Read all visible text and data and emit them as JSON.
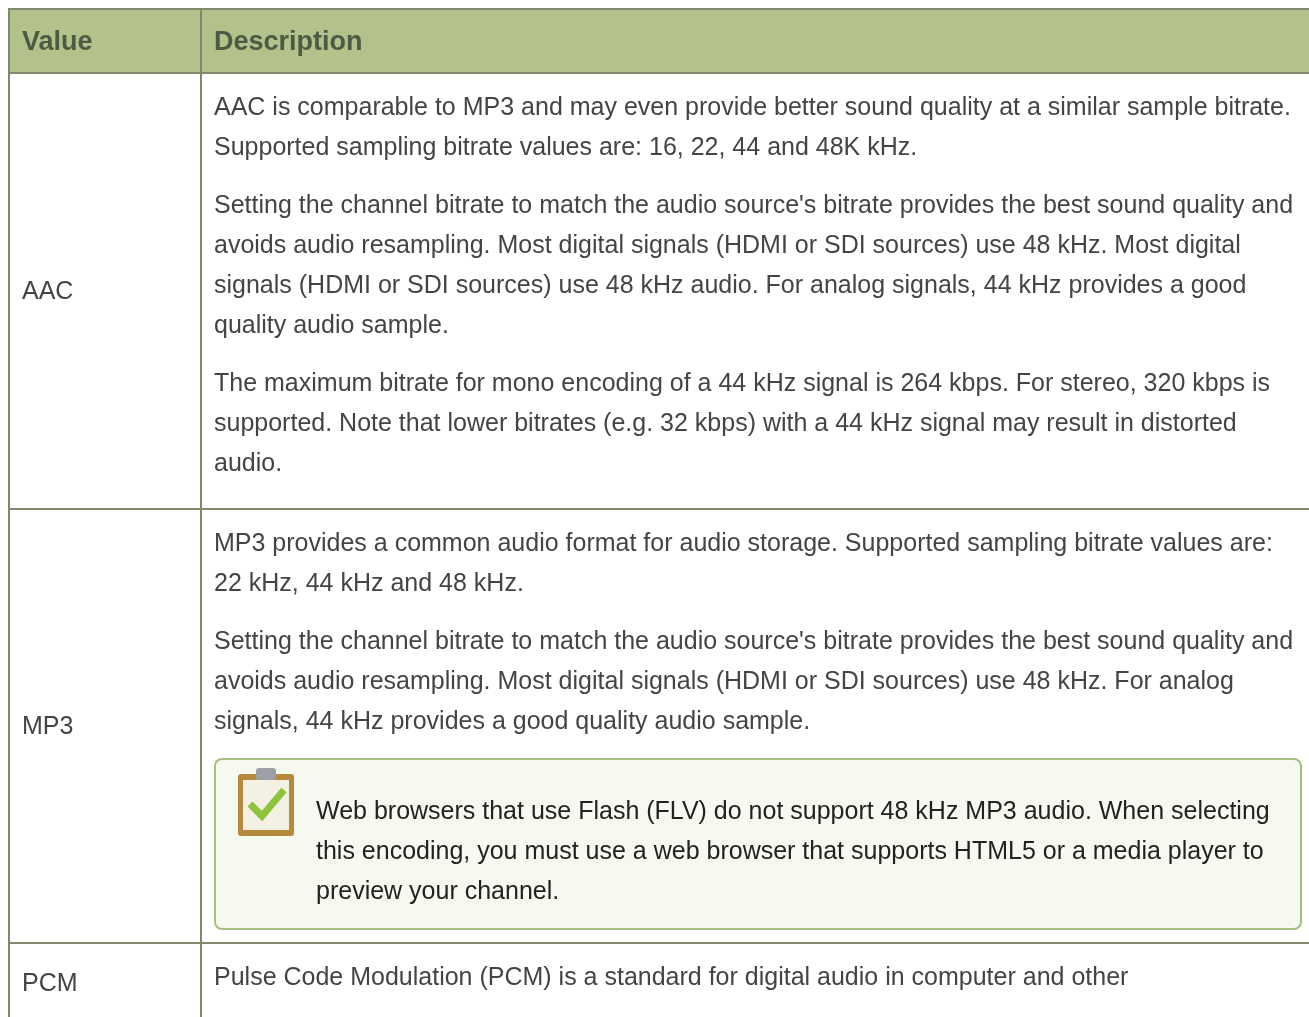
{
  "table": {
    "columns": [
      "Value",
      "Description"
    ],
    "rows": [
      {
        "value": "AAC",
        "paragraphs": [
          "AAC is comparable to MP3 and may even provide better sound quality at a similar sample bitrate. Supported sampling bitrate values are: 16, 22, 44 and 48K kHz.",
          "Setting the channel bitrate to match the audio source's bitrate provides the best sound quality and avoids audio resampling. Most digital signals (HDMI or SDI sources) use 48 kHz. Most digital signals (HDMI or SDI sources) use 48 kHz audio. For analog signals, 44 kHz provides a good quality audio sample.",
          "The maximum bitrate for mono encoding of a 44 kHz signal is 264 kbps. For stereo, 320 kbps is supported. Note that lower bitrates (e.g. 32 kbps) with a 44 kHz signal may result in distorted audio."
        ]
      },
      {
        "value": "MP3",
        "paragraphs": [
          "MP3 provides a common audio format for audio storage. Supported sampling bitrate values are: 22 kHz, 44 kHz and 48 kHz.",
          "Setting the channel bitrate to match the audio source's bitrate provides the best sound quality and avoids audio resampling. Most digital signals (HDMI or SDI sources) use 48 kHz. For analog signals, 44 kHz provides a good quality audio sample."
        ],
        "note": "Web browsers that use Flash (FLV) do not support 48 kHz MP3 audio. When selecting this encoding, you must use a web browser that supports HTML5 or a media player to preview your channel."
      },
      {
        "value": "PCM",
        "paragraphs": [
          "Pulse Code Modulation (PCM) is a standard for digital audio in computer and other"
        ]
      }
    ]
  }
}
